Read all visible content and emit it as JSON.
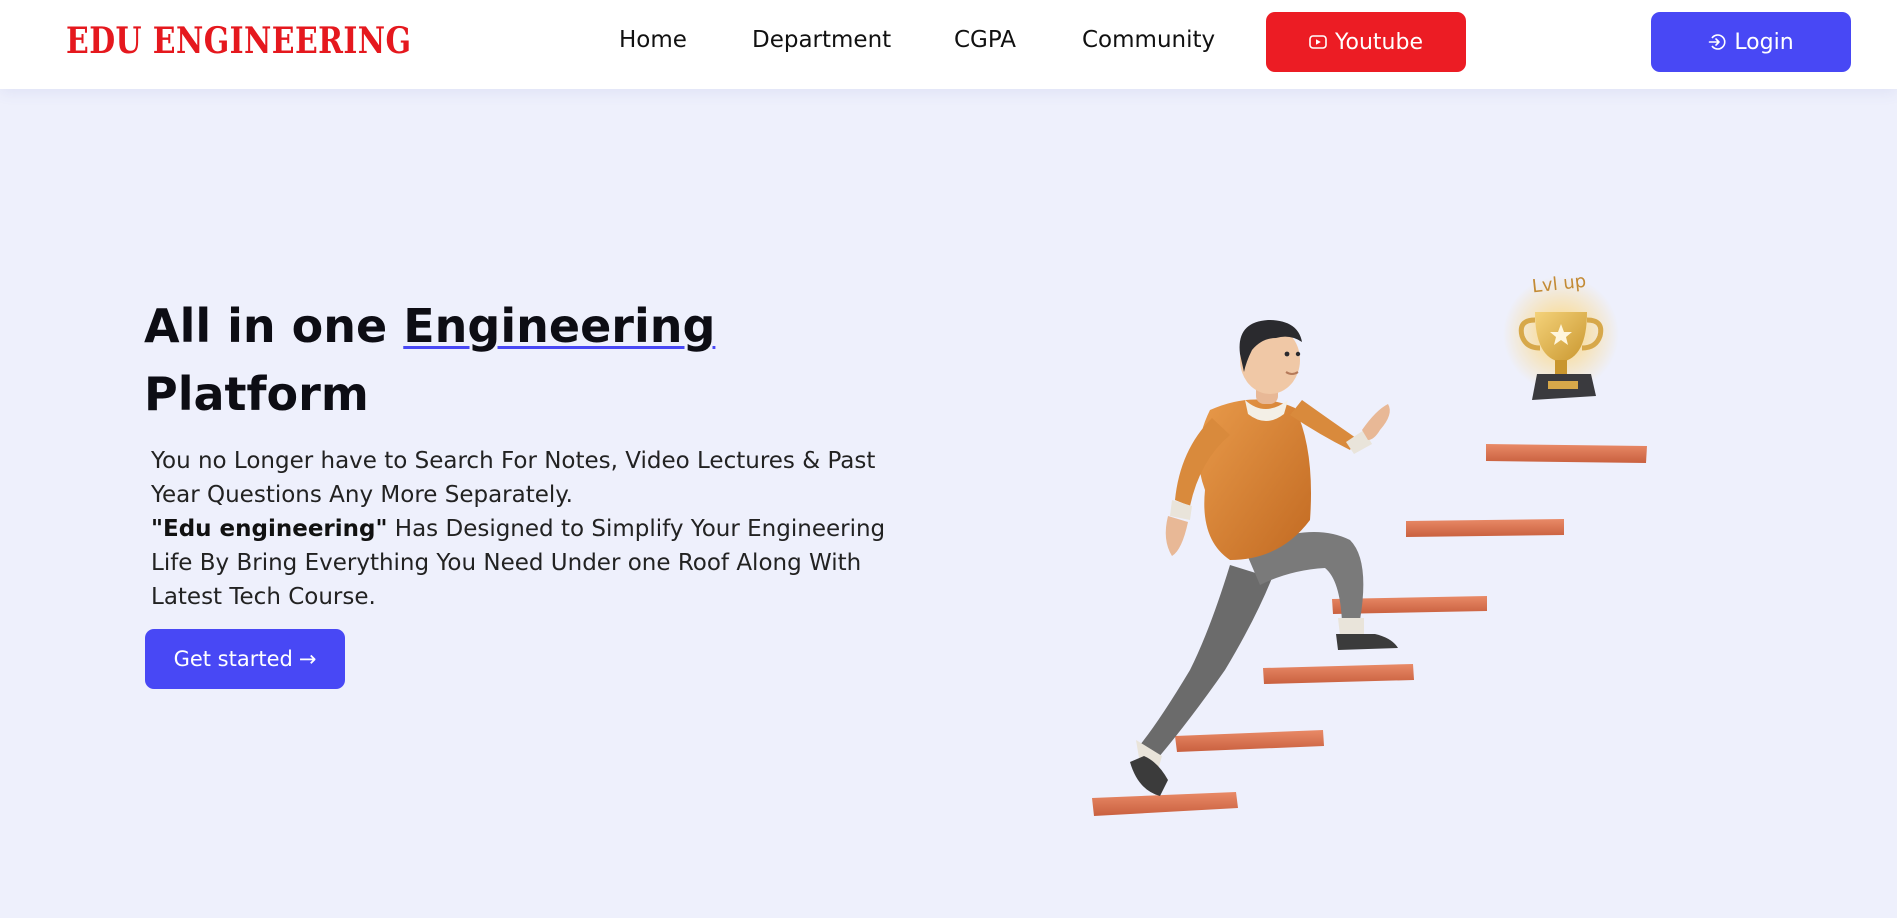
{
  "header": {
    "logo": "EDU ENGINEERING",
    "nav": [
      "Home",
      "Department",
      "CGPA",
      "Community"
    ],
    "youtube_label": "Youtube",
    "login_label": "Login"
  },
  "hero": {
    "title_part1": "All in one ",
    "title_highlight": "Engineering",
    "title_part2": "Platform",
    "paragraph1": "You no Longer have to Search For Notes, Video Lectures & Past Year Questions Any More Separately.",
    "brand_quote": "\"Edu engineering\"",
    "paragraph2": " Has Designed to Simplify Your Engineering Life By Bring Everything You Need Under one Roof Along With Latest Tech Course.",
    "cta_label": "Get started",
    "cta_arrow": "→"
  },
  "illustration": {
    "trophy_label": "Lvl up"
  },
  "colors": {
    "brand_red": "#e5181e",
    "youtube_red": "#ec1c24",
    "primary_blue": "#4848f5",
    "background": "#eef0fc"
  },
  "icons": {
    "youtube": "youtube-play-icon",
    "login": "login-arrow-icon",
    "cta": "arrow-right-icon"
  }
}
